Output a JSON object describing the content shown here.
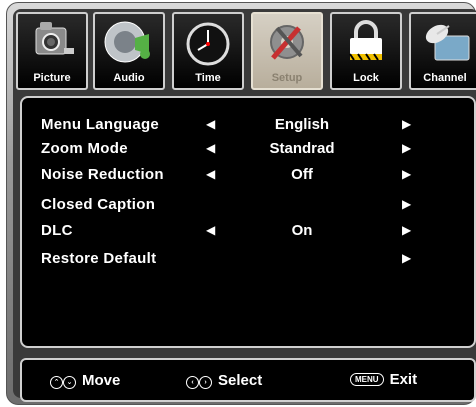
{
  "tabs": [
    {
      "label": "Picture",
      "icon": "camera-icon"
    },
    {
      "label": "Audio",
      "icon": "speaker-icon"
    },
    {
      "label": "Time",
      "icon": "clock-icon"
    },
    {
      "label": "Setup",
      "icon": "gear-wrench-icon",
      "active": true
    },
    {
      "label": "Lock",
      "icon": "padlock-icon"
    },
    {
      "label": "Channel",
      "icon": "satellite-dish-icon"
    }
  ],
  "menu": {
    "items": [
      {
        "name": "Menu  Language",
        "value": "English",
        "left_arrow": "◀",
        "right_arrow": "▶"
      },
      {
        "name": "Zoom  Mode",
        "value": "Standrad",
        "left_arrow": "◀",
        "right_arrow": "▶"
      },
      {
        "name": "Noise  Reduction",
        "value": "Off",
        "left_arrow": "◀",
        "right_arrow": "▶"
      },
      {
        "name": "Closed  Caption",
        "value": "",
        "left_arrow": "",
        "right_arrow": "▶"
      },
      {
        "name": "DLC",
        "value": "On",
        "left_arrow": "◀",
        "right_arrow": "▶"
      },
      {
        "name": "Restore Default",
        "value": "",
        "left_arrow": "",
        "right_arrow": "▶"
      }
    ]
  },
  "footer": {
    "move_label": "Move",
    "select_label": "Select",
    "exit_label": "Exit",
    "menu_key": "MENU",
    "up_glyph": "⌃",
    "down_glyph": "⌄",
    "left_glyph": "‹",
    "right_glyph": "›"
  },
  "colors": {
    "active_tab": "#b8ae9c",
    "panel": "#000000",
    "text": "#ffffff"
  }
}
